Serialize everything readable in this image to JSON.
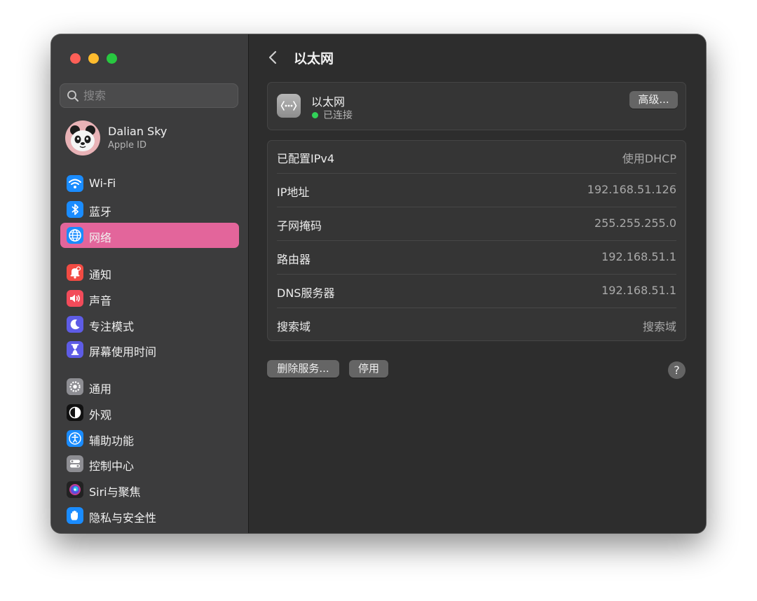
{
  "sidebar": {
    "search": {
      "placeholder": "搜索"
    },
    "profile": {
      "name": "Dalian Sky",
      "subtitle": "Apple ID"
    },
    "groups": [
      [
        {
          "label": "Wi-Fi",
          "icon": "wifi-icon",
          "color": "#1a8cff"
        },
        {
          "label": "蓝牙",
          "icon": "bluetooth-icon",
          "color": "#1a8cff"
        },
        {
          "label": "网络",
          "icon": "globe-icon",
          "color": "#1a8cff",
          "selected": true
        }
      ],
      [
        {
          "label": "通知",
          "icon": "bell-icon",
          "color": "#f24b43"
        },
        {
          "label": "声音",
          "icon": "speaker-icon",
          "color": "#f24b5a"
        },
        {
          "label": "专注模式",
          "icon": "moon-icon",
          "color": "#5e5ce6"
        },
        {
          "label": "屏幕使用时间",
          "icon": "hourglass-icon",
          "color": "#5e5ce6"
        }
      ],
      [
        {
          "label": "通用",
          "icon": "gear-icon",
          "color": "#8e8e93"
        },
        {
          "label": "外观",
          "icon": "appearance-icon",
          "color": "#111111"
        },
        {
          "label": "辅助功能",
          "icon": "accessibility-icon",
          "color": "#1a8cff"
        },
        {
          "label": "控制中心",
          "icon": "toggles-icon",
          "color": "#8e8e93"
        },
        {
          "label": "Siri与聚焦",
          "icon": "siri-icon",
          "color": "#222222"
        },
        {
          "label": "隐私与安全性",
          "icon": "hand-icon",
          "color": "#1a8cff"
        }
      ]
    ],
    "selected_color": "#e3659b"
  },
  "main": {
    "title": "以太网",
    "service": {
      "name": "以太网",
      "status": "已连接",
      "status_color": "#31d158",
      "advanced_label": "高级..."
    },
    "rows": [
      {
        "label": "已配置IPv4",
        "value": "使用DHCP"
      },
      {
        "label": "IP地址",
        "value": "192.168.51.126"
      },
      {
        "label": "子网掩码",
        "value": "255.255.255.0"
      },
      {
        "label": "路由器",
        "value": "192.168.51.1"
      },
      {
        "label": "DNS服务器",
        "value": "192.168.51.1"
      },
      {
        "label": "搜索域",
        "value": "搜索域"
      }
    ],
    "delete_label": "删除服务...",
    "disable_label": "停用",
    "help_label": "?"
  }
}
